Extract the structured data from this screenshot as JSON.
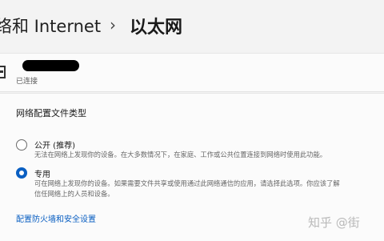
{
  "header": {
    "parent": "络和 Internet",
    "separator": "›",
    "current": "以太网"
  },
  "connection": {
    "status": "已连接"
  },
  "profile": {
    "section_title": "网络配置文件类型",
    "options": [
      {
        "label": "公开 (推荐)",
        "description": "无法在网络上发现你的设备。在大多数情况下，在家庭、工作或公共位置连接到网络时使用此功能。",
        "selected": false
      },
      {
        "label": "专用",
        "description_line1": "可在网络上发现你的设备。如果需要文件共享或使用通过此网络通信的应用，请选择此选项。你应该了解",
        "description_line2": "信任网络上的人员和设备。",
        "selected": true
      }
    ],
    "firewall_link": "配置防火墙和安全设置"
  },
  "watermark": "知乎 @街",
  "colors": {
    "accent": "#0a5fc2",
    "background": "#f3f3f3",
    "card": "#fbfbfb"
  }
}
